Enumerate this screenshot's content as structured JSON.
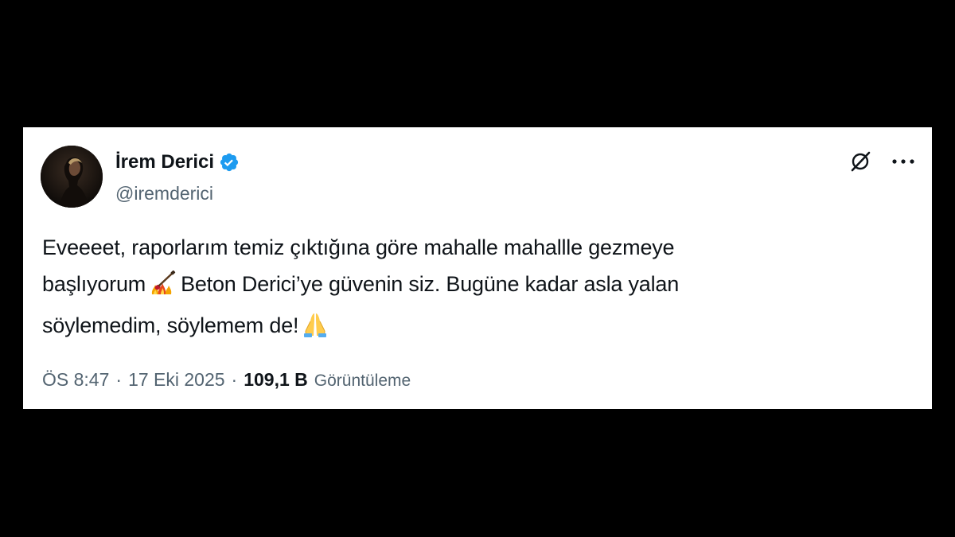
{
  "tweet": {
    "author": {
      "name": "İrem Derici",
      "handle": "@iremderici",
      "verified": true
    },
    "text_lines": [
      "Eveeeet, raporlarım temiz çıktığına göre mahalle mahallle gezmeye",
      "başlıyorum",
      "Beton Derici’ye güvenin siz. Bugüne kadar asla yalan",
      "söylemedim, söylemem de!"
    ],
    "emojis": [
      "guitar-fire-emoji",
      "folded-hands-emoji"
    ],
    "time": "ÖS 8:47",
    "date": "17 Eki 2025",
    "separator": "·",
    "views_count": "109,1 B",
    "views_label": "Görüntüleme"
  },
  "icons": {
    "grok": "grok-icon",
    "more": "more-icon",
    "verified": "verified-badge-icon"
  },
  "colors": {
    "background": "#000000",
    "card": "#ffffff",
    "text_primary": "#0f1419",
    "text_secondary": "#536471",
    "verified_blue": "#1d9bf0"
  }
}
